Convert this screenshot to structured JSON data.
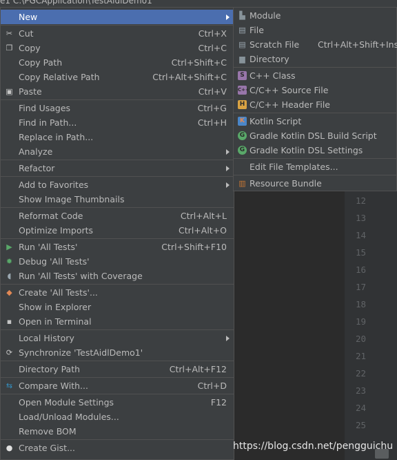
{
  "window": {
    "path": "e1  C:\\PGCApplication\\TestAidlDemo1"
  },
  "main_menu": {
    "new": "New",
    "cut": "Cut",
    "cut_sc": "Ctrl+X",
    "copy": "Copy",
    "copy_sc": "Ctrl+C",
    "copy_path": "Copy Path",
    "copy_path_sc": "Ctrl+Shift+C",
    "copy_rel": "Copy Relative Path",
    "copy_rel_sc": "Ctrl+Alt+Shift+C",
    "paste": "Paste",
    "paste_sc": "Ctrl+V",
    "find_usages": "Find Usages",
    "find_usages_sc": "Ctrl+G",
    "find_path": "Find in Path...",
    "find_path_sc": "Ctrl+H",
    "replace_path": "Replace in Path...",
    "analyze": "Analyze",
    "refactor": "Refactor",
    "favorites": "Add to Favorites",
    "thumbnails": "Show Image Thumbnails",
    "reformat": "Reformat Code",
    "reformat_sc": "Ctrl+Alt+L",
    "optimize": "Optimize Imports",
    "optimize_sc": "Ctrl+Alt+O",
    "run": "Run 'All Tests'",
    "run_sc": "Ctrl+Shift+F10",
    "debug": "Debug 'All Tests'",
    "coverage": "Run 'All Tests' with Coverage",
    "create": "Create 'All Tests'...",
    "explorer": "Show in Explorer",
    "terminal": "Open in Terminal",
    "history": "Local History",
    "sync": "Synchronize 'TestAidlDemo1'",
    "dir_path": "Directory Path",
    "dir_path_sc": "Ctrl+Alt+F12",
    "compare": "Compare With...",
    "compare_sc": "Ctrl+D",
    "module_settings": "Open Module Settings",
    "module_settings_sc": "F12",
    "load_modules": "Load/Unload Modules...",
    "remove_bom": "Remove BOM",
    "gist": "Create Gist..."
  },
  "sub_menu": {
    "module": "Module",
    "file": "File",
    "scratch": "Scratch File",
    "scratch_sc": "Ctrl+Alt+Shift+Insert",
    "directory": "Directory",
    "cpp_class": "C++ Class",
    "cpp_source": "C/C++ Source File",
    "cpp_header": "C/C++ Header File",
    "kotlin_script": "Kotlin Script",
    "gradle_build": "Gradle Kotlin DSL Build Script",
    "gradle_settings": "Gradle Kotlin DSL Settings",
    "templates": "Edit File Templates...",
    "bundle": "Resource Bundle"
  },
  "editor": {
    "line_numbers": [
      "12",
      "13",
      "14",
      "15",
      "16",
      "17",
      "18",
      "19",
      "20",
      "21",
      "22",
      "23",
      "24",
      "25"
    ]
  },
  "watermark": "https://blog.csdn.net/pengguichu",
  "colors": {
    "menu_bg": "#3c3f41",
    "selected": "#4b6eaf",
    "editor_bg": "#2b2b2b",
    "text": "#bbbbbb"
  }
}
